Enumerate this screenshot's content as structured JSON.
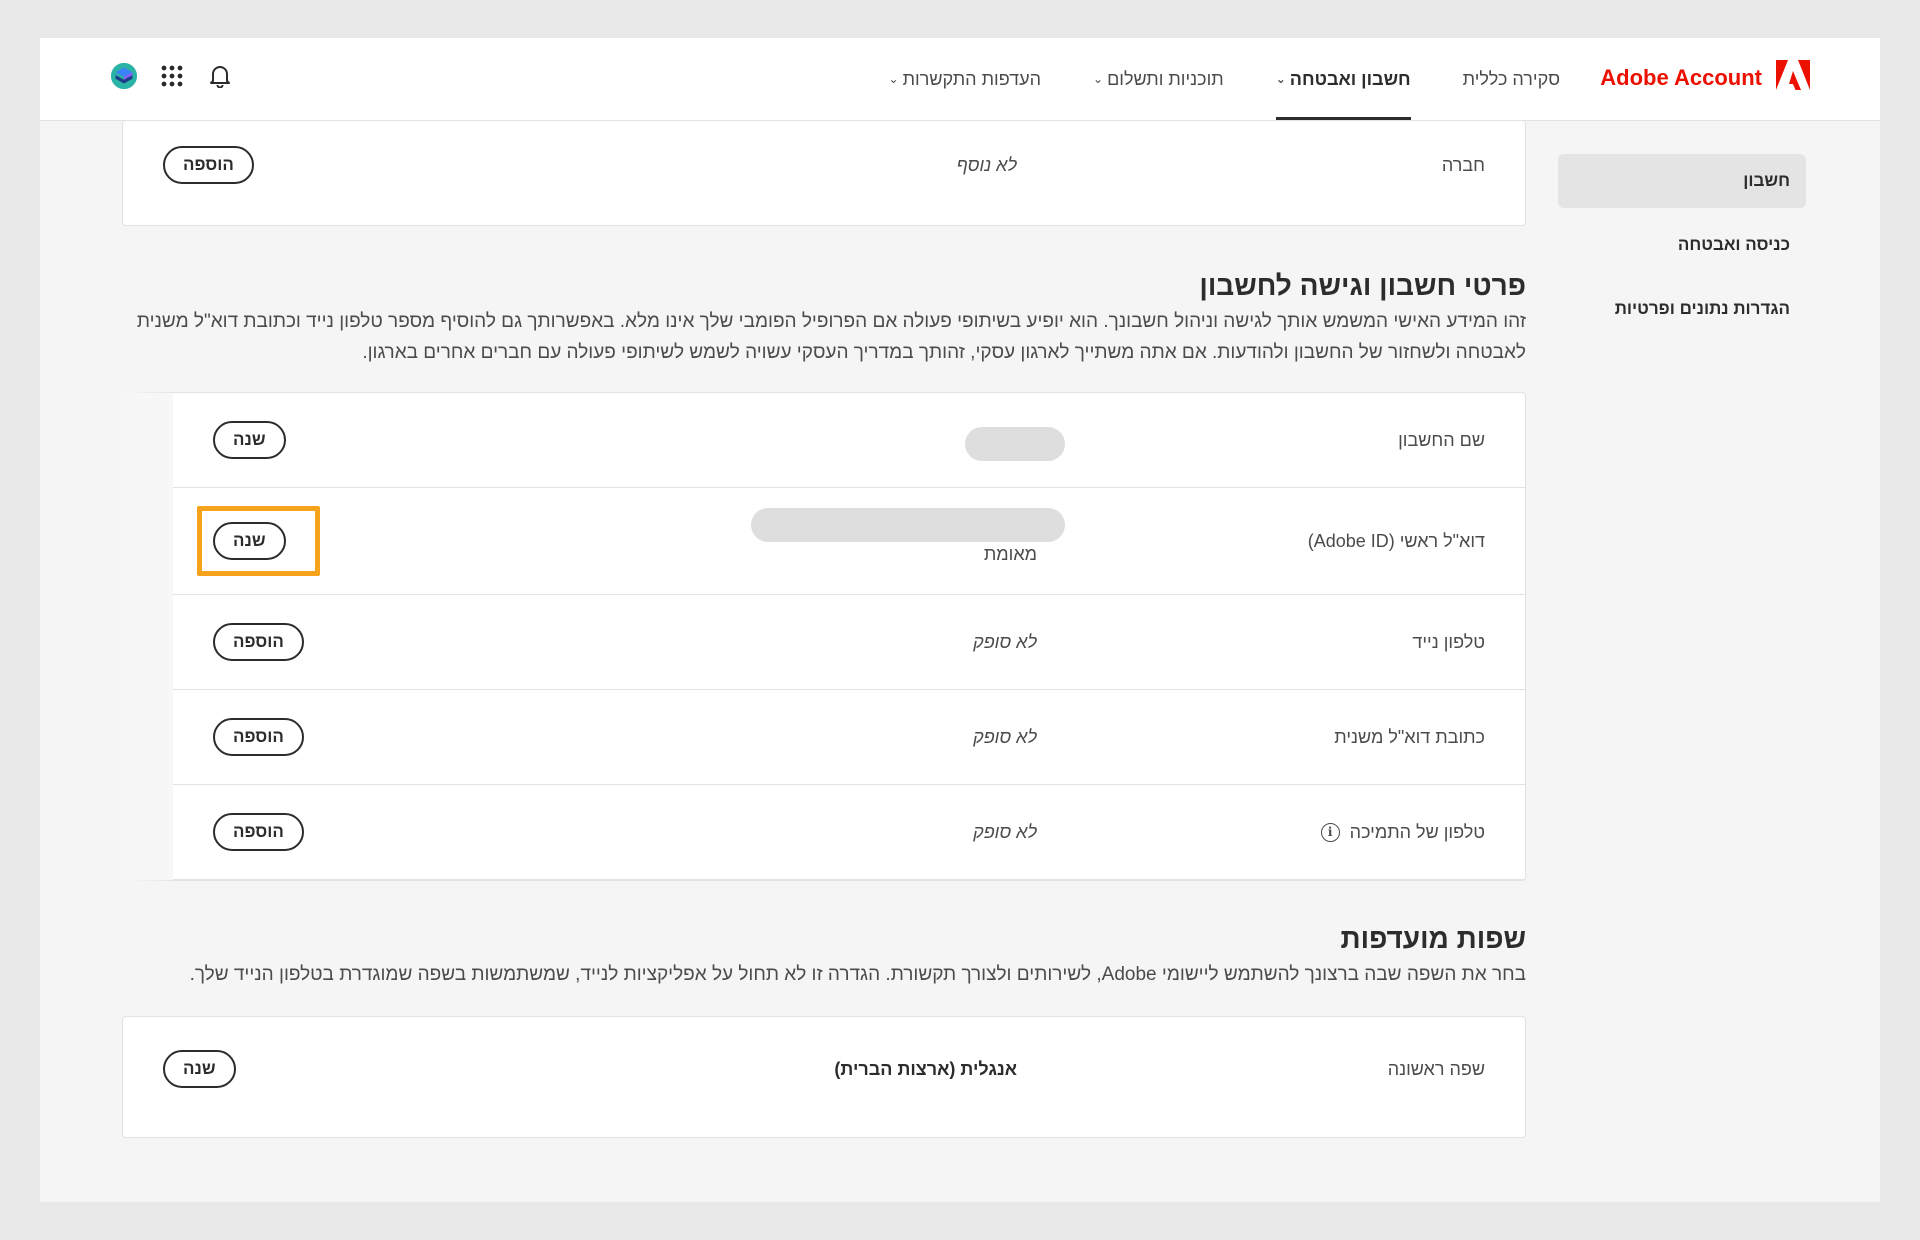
{
  "header": {
    "brand": "Adobe Account",
    "nav": [
      {
        "label": "סקירה כללית",
        "dropdown": false,
        "active": false
      },
      {
        "label": "חשבון ואבטחה",
        "dropdown": true,
        "active": true
      },
      {
        "label": "תוכניות ותשלום",
        "dropdown": true,
        "active": false
      },
      {
        "label": "העדפות התקשרות",
        "dropdown": true,
        "active": false
      }
    ],
    "icons": [
      "avatar-icon",
      "apps-grid-icon",
      "notification-bell-icon"
    ]
  },
  "sidebar": {
    "items": [
      {
        "label": "חשבון",
        "active": true
      },
      {
        "label": "כניסה ואבטחה",
        "active": false
      },
      {
        "label": "הגדרות נתונים ופרטיות",
        "active": false
      }
    ]
  },
  "company_card": {
    "label": "חברה",
    "value": "לא נוסף",
    "button": "הוספה"
  },
  "account_section": {
    "title": "פרטי חשבון וגישה לחשבון",
    "description": "זהו המידע האישי המשמש אותך לגישה וניהול חשבונך. הוא יופיע בשיתופי פעולה אם הפרופיל הפומבי שלך אינו מלא. באפשרותך גם להוסיף מספר טלפון נייד וכתובת דוא\"ל משנית לאבטחה ולשחזור של החשבון ולהודעות. אם אתה משתייך לארגון עסקי, זהותך במדריך העסקי עשויה לשמש לשיתופי פעולה עם חברים אחרים בארגון.",
    "rows": [
      {
        "label": "שם החשבון",
        "value": "",
        "sub": "",
        "button": "שנה"
      },
      {
        "label": "דוא\"ל ראשי (Adobe ID)",
        "value": "",
        "sub": "מאומת",
        "button": "שנה"
      },
      {
        "label": "טלפון נייד",
        "value": "לא סופק",
        "sub": "",
        "button": "הוספה"
      },
      {
        "label": "כתובת דוא\"ל משנית",
        "value": "לא סופק",
        "sub": "",
        "button": "הוספה"
      },
      {
        "label": "טלפון של התמיכה",
        "value": "לא סופק",
        "sub": "",
        "button": "הוספה"
      }
    ]
  },
  "language_section": {
    "title": "שפות מועדפות",
    "description": "בחר את השפה שבה ברצונך להשתמש ליישומי Adobe, לשירותים ולצורך תקשורת. הגדרה זו לא תחול על אפליקציות לנייד, שמשתמשות בשפה שמוגדרת בטלפון הנייד שלך.",
    "row": {
      "label": "שפה ראשונה",
      "value": "אנגלית (ארצות הברית)",
      "button": "שנה"
    }
  },
  "colors": {
    "brand_red": "#eb1000",
    "highlight": "#f7a21b",
    "text": "#2c2c2c"
  }
}
